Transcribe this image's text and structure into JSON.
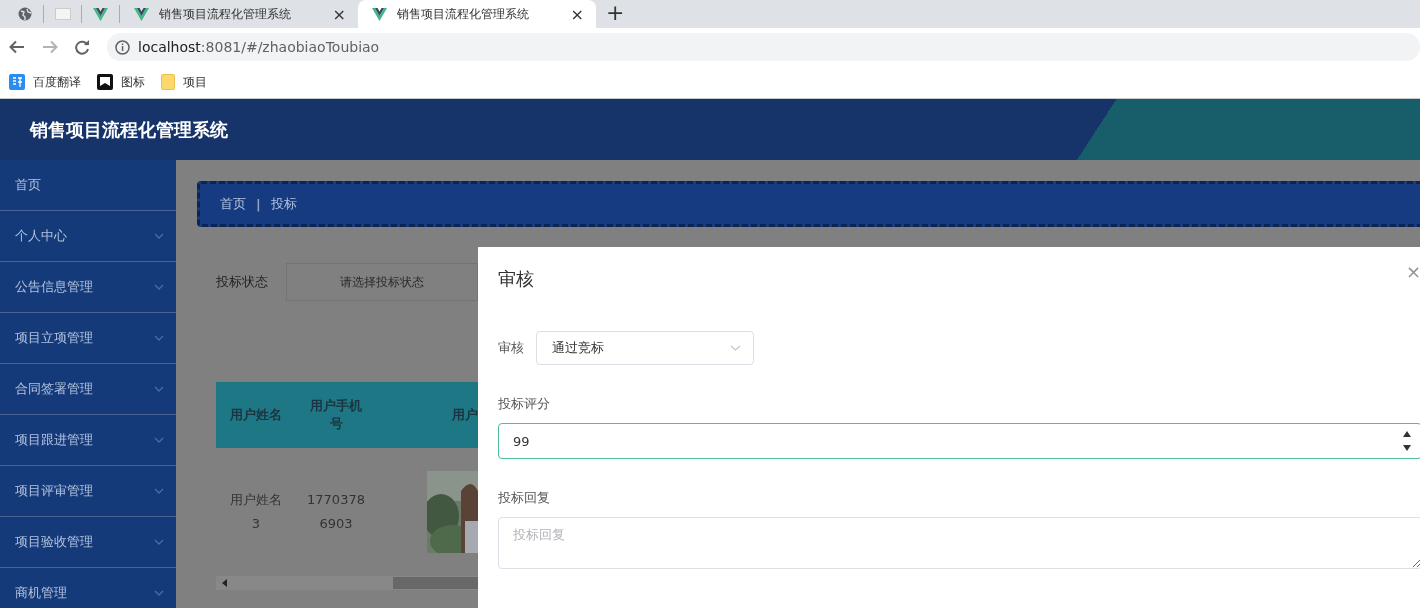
{
  "browser": {
    "tabs": [
      {
        "kind": "globe",
        "selected": false
      },
      {
        "kind": "page",
        "selected": false
      },
      {
        "kind": "vue",
        "selected": false
      },
      {
        "kind": "vue",
        "title": "销售项目流程化管理系统",
        "close": "×",
        "selected": false
      },
      {
        "kind": "vue",
        "title": "销售项目流程化管理系统",
        "close": "×",
        "selected": true
      }
    ],
    "new_tab": "+",
    "url_host": "localhost",
    "url_rest": ":8081/#/zhaobiaoToubiao",
    "bookmarks": [
      {
        "kind": "translate",
        "label": "百度翻译"
      },
      {
        "kind": "flag",
        "label": "图标"
      },
      {
        "kind": "folder",
        "label": "项目"
      }
    ]
  },
  "app": {
    "title": "销售项目流程化管理系统",
    "sidebar": [
      {
        "label": "首页",
        "kind": "link"
      },
      {
        "label": "个人中心",
        "kind": "submenu"
      },
      {
        "label": "公告信息管理",
        "kind": "submenu"
      },
      {
        "label": "项目立项管理",
        "kind": "submenu"
      },
      {
        "label": "合同签署管理",
        "kind": "submenu"
      },
      {
        "label": "项目跟进管理",
        "kind": "submenu"
      },
      {
        "label": "项目评审管理",
        "kind": "submenu"
      },
      {
        "label": "项目验收管理",
        "kind": "submenu"
      },
      {
        "label": "商机管理",
        "kind": "submenu"
      }
    ],
    "breadcrumb": [
      "首页",
      "投标"
    ],
    "breadcrumb_sep": "|",
    "filter": {
      "label": "投标状态",
      "placeholder": "请选择投标状态"
    },
    "table": {
      "columns": [
        "用户姓名",
        "用户手机号",
        "用户"
      ],
      "rows": [
        {
          "cells": [
            "用户姓名3",
            "17703786903"
          ],
          "photo": {
            "kind": "picture"
          }
        }
      ]
    }
  },
  "dialog": {
    "title": "审核",
    "close": "×",
    "fields": [
      {
        "kind": "select",
        "label": "审核",
        "value": "通过竞标"
      },
      {
        "kind": "number",
        "label": "投标评分",
        "value": "99"
      },
      {
        "kind": "textarea",
        "label": "投标回复",
        "placeholder": "投标回复"
      }
    ]
  }
}
